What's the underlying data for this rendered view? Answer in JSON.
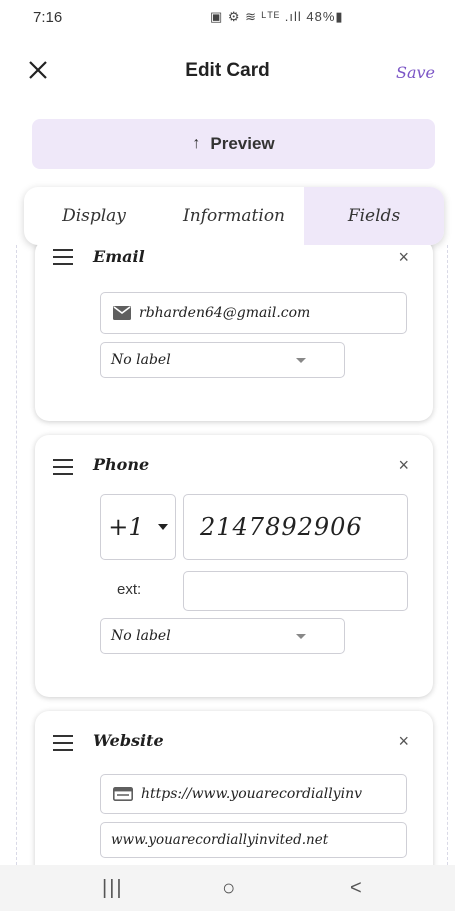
{
  "status_bar": {
    "time": "7:16",
    "indicators": "▣ ⚙ ≋ ᴸᵀᴱ .ıll 48%▮"
  },
  "header": {
    "title": "Edit Card",
    "save_label": "Save",
    "close_icon": "close-icon"
  },
  "preview": {
    "label": "Preview",
    "arrow": "↑"
  },
  "tabs": [
    {
      "label": "Display",
      "active": false
    },
    {
      "label": "Information",
      "active": false
    },
    {
      "label": "Fields",
      "active": true
    }
  ],
  "fields": {
    "email": {
      "title": "Email",
      "remove": "×",
      "value": "rbharden64@gmail.com",
      "label_select": "No label"
    },
    "phone": {
      "title": "Phone",
      "remove": "×",
      "country_code": "+1",
      "number": "2147892906",
      "ext_label": "ext:",
      "ext_value": "",
      "label_select": "No label"
    },
    "website": {
      "title": "Website",
      "remove": "×",
      "url": "https://www.youarecordiallyinv",
      "display_text": "www.youarecordiallyinvited.net"
    }
  },
  "navbar": {
    "recents": "|||",
    "home": "○",
    "back": "<"
  },
  "colors": {
    "accent": "#7b55c6",
    "preview_bg": "#efe8f9",
    "active_tab_bg": "#efe8f9"
  }
}
